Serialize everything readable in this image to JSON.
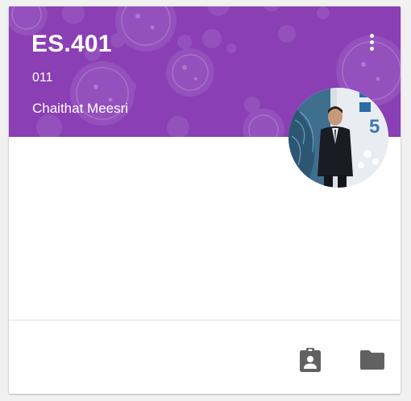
{
  "card": {
    "title": "ES.401",
    "section": "011",
    "teacher": "Chaithat Meesri",
    "header_color": "#8a3fb4",
    "avatar": "teacher-photo",
    "menu_icon": "more-vert-icon",
    "footer_icons": [
      "assignment-ind-icon",
      "folder-icon"
    ],
    "icon_color": "#616161"
  }
}
